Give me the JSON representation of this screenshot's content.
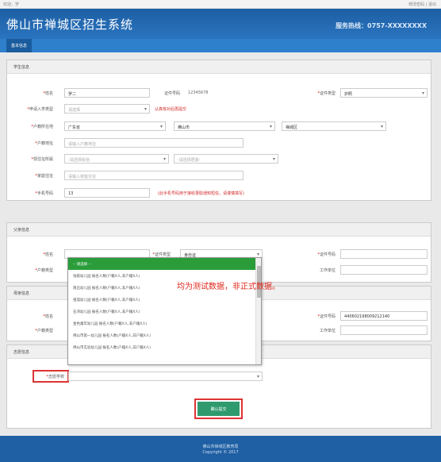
{
  "topbar": {
    "left": "欢迎，罗",
    "right": "修改密码 | 退出"
  },
  "header": {
    "title": "佛山市禅城区招生系统",
    "hotline": "服务热线：0757-XXXXXXXX"
  },
  "nav": {
    "tab": "基本信息"
  },
  "student": {
    "title": "学生信息",
    "name_label": "姓名",
    "name_value": "罗二",
    "cert_no_label": "证件号码",
    "cert_no_value": "12345678",
    "cert_type_label": "证件类型",
    "cert_type_value": "护照",
    "entry_type_label": "申请入学类型",
    "entry_type_placeholder": "请选择",
    "entry_type_warn": "认真核对后再提交",
    "hukou_label": "户籍所在地",
    "province": "广东省",
    "city": "佛山市",
    "district": "禅城区",
    "hukou_addr_label": "户籍地址",
    "hukou_addr_placeholder": "请输入户籍地址",
    "residence_label": "现住址所属",
    "residence_sel1": "-请选择街道-",
    "residence_sel2": "-请选择居委-",
    "home_addr_label": "家庭住址",
    "home_addr_placeholder": "请输入家庭住址",
    "phone_label": "手机号码",
    "phone_value": "13",
    "phone_warn": "(此手机号码用于接收录取通知短信，请谨慎填写)"
  },
  "parent1": {
    "title": "父亲信息",
    "name_label": "姓名",
    "cert_type_label": "证件类型",
    "cert_type_value": "身份证",
    "cert_no_label": "证件号码",
    "hukou_type_label": "户籍类型",
    "work_label": "工作单位"
  },
  "parent2": {
    "title": "母亲信息",
    "name_label": "姓名",
    "cert_no_label": "证件号码",
    "cert_no_value": "440602198009212140",
    "hukou_type_label": "户籍类型",
    "work_label": "工作单位"
  },
  "school": {
    "title": "志愿信息",
    "label": "志愿学校",
    "submit": "确认提交"
  },
  "dropdown": {
    "options": [
      "-- 请选择 --",
      "张槎幼儿园 报名人数(户籍X人,非户籍X人)",
      "南庄幼儿园 报名人数(户籍X人,非户籍X人)",
      "祖庙幼儿园 报名人数(户籍X人,非户籍X人)",
      "石湾幼儿园 报名人数(户籍X人,非户籍X人)",
      "金色童年幼儿园 报名人数(户籍X人,非户籍X人)",
      "佛山市第一幼儿园 报名人数(户籍X人,非户籍X人)",
      "佛山市实验幼儿园 报名人数(户籍X人,非户籍X人)"
    ]
  },
  "overlay": "均为测试数据，非正式数据。",
  "footer": {
    "line1": "佛山市禅城区教育局",
    "line2": "Copyright © 2017"
  }
}
